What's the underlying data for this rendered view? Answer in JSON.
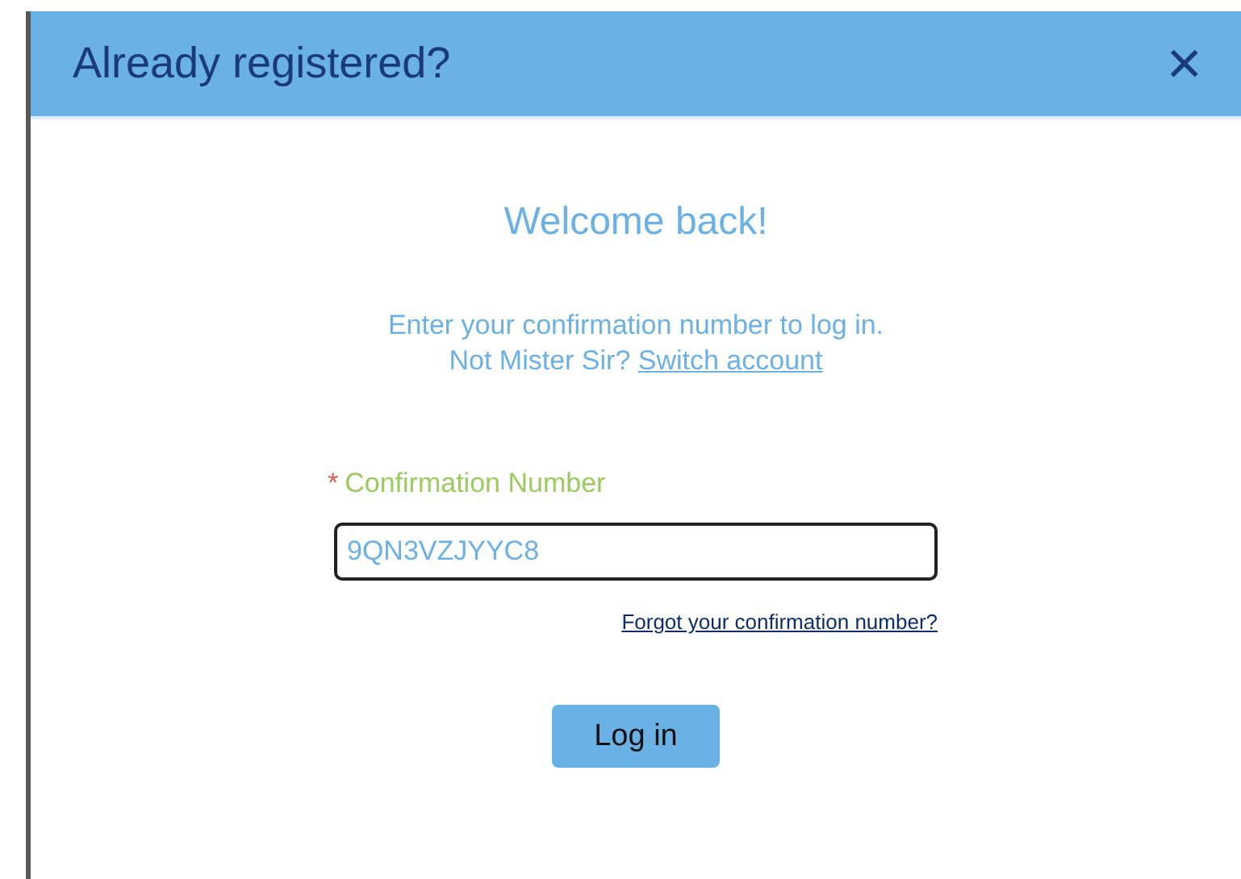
{
  "dialog": {
    "title": "Already registered?",
    "close": "×"
  },
  "heading": "Welcome back!",
  "instructions": "Enter your confirmation number to log in.",
  "account_line": {
    "text": "Not Mister Sir? ",
    "link": "Switch account"
  },
  "field": {
    "required_mark": "*",
    "label": "Confirmation Number",
    "value": "9QN3VZJYYC8",
    "focused": true
  },
  "forgot_link": "Forgot your confirmation number?",
  "buttons": [
    "Log in"
  ]
}
